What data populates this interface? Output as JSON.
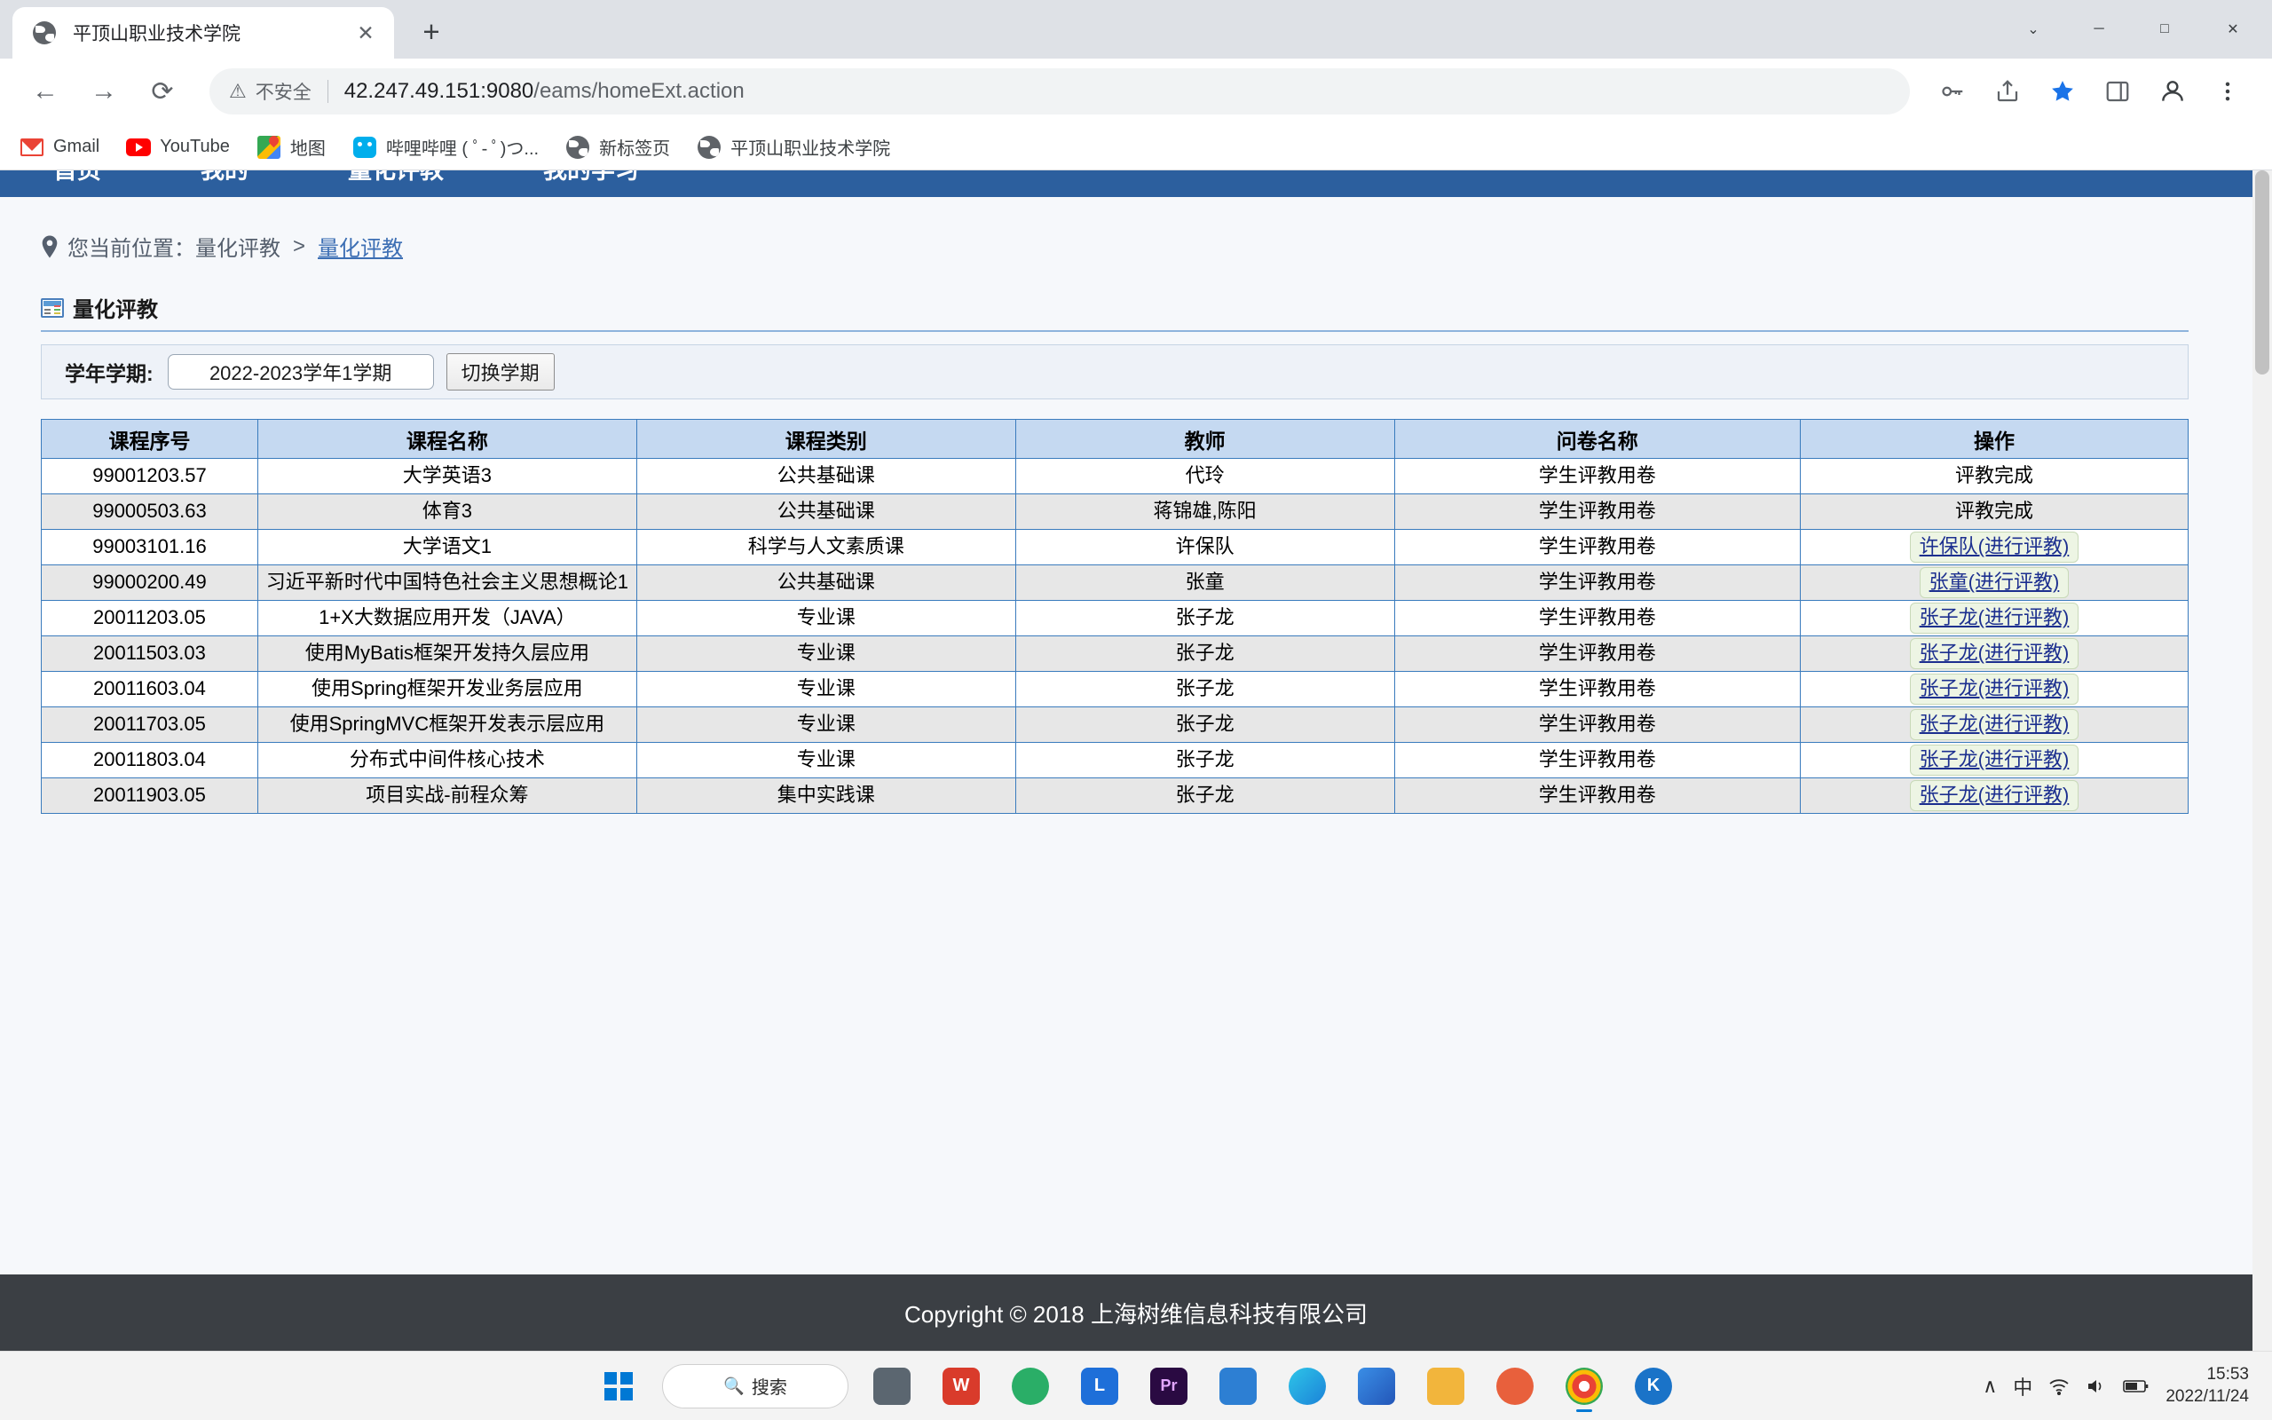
{
  "browser": {
    "tab": {
      "title": "平顶山职业技术学院",
      "close_label": "✕"
    },
    "new_tab_label": "+",
    "nav": {
      "back": "←",
      "forward": "→",
      "reload": "⟳"
    },
    "omnibox": {
      "security_label": "不安全",
      "url_host": "42.247.49.151:9080",
      "url_path": "/eams/homeExt.action"
    },
    "bookmarks": [
      {
        "label": "Gmail",
        "icon": "gmail-icon"
      },
      {
        "label": "YouTube",
        "icon": "youtube-icon"
      },
      {
        "label": "地图",
        "icon": "google-maps-icon"
      },
      {
        "label": "哔哩哔哩 ( ﾟ- ﾟ)つ...",
        "icon": "bilibili-icon"
      },
      {
        "label": "新标签页",
        "icon": "globe-icon"
      },
      {
        "label": "平顶山职业技术学院",
        "icon": "globe-icon"
      }
    ],
    "window_controls": {
      "minimize": "─",
      "maximize": "□",
      "close": "✕",
      "chevron": "⌄"
    }
  },
  "site": {
    "nav_items": [
      "首页",
      "我的",
      "量化评教",
      "我的学习"
    ],
    "breadcrumb": {
      "prefix": "您当前位置：",
      "parent": "量化评教",
      "separator": ">",
      "current": "量化评教"
    },
    "panel_title": "量化评教",
    "filter": {
      "label": "学年学期:",
      "term_value": "2022-2023学年1学期",
      "switch_button": "切换学期"
    },
    "table": {
      "headers": [
        "课程序号",
        "课程名称",
        "课程类别",
        "教师",
        "问卷名称",
        "操作"
      ],
      "rows": [
        {
          "no": "99001203.57",
          "name": "大学英语3",
          "type": "公共基础课",
          "teacher": "代玲",
          "paper": "学生评教用卷",
          "op": "评教完成",
          "op_link": false
        },
        {
          "no": "99000503.63",
          "name": "体育3",
          "type": "公共基础课",
          "teacher": "蒋锦雄,陈阳",
          "paper": "学生评教用卷",
          "op": "评教完成",
          "op_link": false
        },
        {
          "no": "99003101.16",
          "name": "大学语文1",
          "type": "科学与人文素质课",
          "teacher": "许保队",
          "paper": "学生评教用卷",
          "op": "许保队(进行评教)",
          "op_link": true
        },
        {
          "no": "99000200.49",
          "name": "习近平新时代中国特色社会主义思想概论1",
          "type": "公共基础课",
          "teacher": "张童",
          "paper": "学生评教用卷",
          "op": "张童(进行评教)",
          "op_link": true
        },
        {
          "no": "20011203.05",
          "name": "1+X大数据应用开发（JAVA）",
          "type": "专业课",
          "teacher": "张子龙",
          "paper": "学生评教用卷",
          "op": "张子龙(进行评教)",
          "op_link": true
        },
        {
          "no": "20011503.03",
          "name": "使用MyBatis框架开发持久层应用",
          "type": "专业课",
          "teacher": "张子龙",
          "paper": "学生评教用卷",
          "op": "张子龙(进行评教)",
          "op_link": true
        },
        {
          "no": "20011603.04",
          "name": "使用Spring框架开发业务层应用",
          "type": "专业课",
          "teacher": "张子龙",
          "paper": "学生评教用卷",
          "op": "张子龙(进行评教)",
          "op_link": true
        },
        {
          "no": "20011703.05",
          "name": "使用SpringMVC框架开发表示层应用",
          "type": "专业课",
          "teacher": "张子龙",
          "paper": "学生评教用卷",
          "op": "张子龙(进行评教)",
          "op_link": true
        },
        {
          "no": "20011803.04",
          "name": "分布式中间件核心技术",
          "type": "专业课",
          "teacher": "张子龙",
          "paper": "学生评教用卷",
          "op": "张子龙(进行评教)",
          "op_link": true
        },
        {
          "no": "20011903.05",
          "name": "项目实战-前程众筹",
          "type": "集中实践课",
          "teacher": "张子龙",
          "paper": "学生评教用卷",
          "op": "张子龙(进行评教)",
          "op_link": true
        }
      ]
    },
    "footer": "Copyright © 2018 上海树维信息科技有限公司"
  },
  "taskbar": {
    "search_placeholder": "搜索",
    "apps": [
      {
        "name": "start-button",
        "label": ""
      },
      {
        "name": "search-box",
        "label": "搜索"
      },
      {
        "name": "task-view",
        "label": ""
      },
      {
        "name": "wps-office",
        "label": "W"
      },
      {
        "name": "wechat-devtools",
        "label": ""
      },
      {
        "name": "lark",
        "label": "L"
      },
      {
        "name": "premiere-pro",
        "label": "Pr"
      },
      {
        "name": "vs-code",
        "label": ""
      },
      {
        "name": "edge-browser",
        "label": ""
      },
      {
        "name": "media-player",
        "label": ""
      },
      {
        "name": "file-explorer",
        "label": ""
      },
      {
        "name": "editor-app",
        "label": ""
      },
      {
        "name": "chrome-browser",
        "label": ""
      },
      {
        "name": "kingsoft-app",
        "label": "K"
      }
    ],
    "tray": {
      "chevron": "∧",
      "ime": "中",
      "wifi": "📶",
      "volume": "🔊",
      "battery": "🔋"
    },
    "clock": {
      "time": "15:53",
      "date": "2022/11/24"
    }
  }
}
